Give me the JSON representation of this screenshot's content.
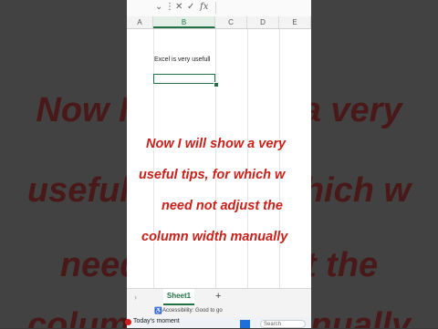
{
  "background_overlay": {
    "lines": [
      "Now I will show a very",
      "useful tips, for which w",
      "need not adjust the",
      "column width manually"
    ]
  },
  "formula_bar": {
    "dropdown_icon": "chevron-down-icon",
    "more_icon": "ellipsis-icon",
    "cancel_icon": "close-icon",
    "confirm_icon": "check-icon",
    "function_label": "fx"
  },
  "columns": [
    "A",
    "B",
    "C",
    "D",
    "E"
  ],
  "active_column": "B",
  "cells": {
    "B2": "Excel is very usefull"
  },
  "caption": {
    "lines": [
      "Now I will show a very",
      "useful tips, for which w",
      "need not adjust the",
      "column width manually"
    ]
  },
  "sheet_bar": {
    "nav_icon": "chevron-right-icon",
    "active_sheet": "Sheet1",
    "add_label": "+"
  },
  "status_bar": {
    "accessibility_text": "Accessibility: Good to go"
  },
  "taskbar": {
    "moment_label": "Today's moment",
    "search_label": "Search"
  },
  "colors": {
    "excel_green": "#217346",
    "caption_red": "#c8201a"
  }
}
